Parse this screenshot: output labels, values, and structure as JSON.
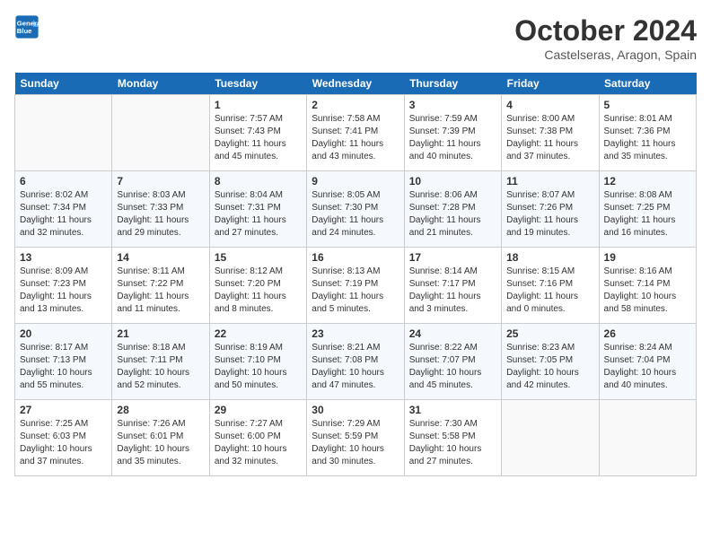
{
  "header": {
    "logo_line1": "General",
    "logo_line2": "Blue",
    "month": "October 2024",
    "location": "Castelseras, Aragon, Spain"
  },
  "days_of_week": [
    "Sunday",
    "Monday",
    "Tuesday",
    "Wednesday",
    "Thursday",
    "Friday",
    "Saturday"
  ],
  "weeks": [
    [
      {
        "day": "",
        "sunrise": "",
        "sunset": "",
        "daylight": ""
      },
      {
        "day": "",
        "sunrise": "",
        "sunset": "",
        "daylight": ""
      },
      {
        "day": "1",
        "sunrise": "Sunrise: 7:57 AM",
        "sunset": "Sunset: 7:43 PM",
        "daylight": "Daylight: 11 hours and 45 minutes."
      },
      {
        "day": "2",
        "sunrise": "Sunrise: 7:58 AM",
        "sunset": "Sunset: 7:41 PM",
        "daylight": "Daylight: 11 hours and 43 minutes."
      },
      {
        "day": "3",
        "sunrise": "Sunrise: 7:59 AM",
        "sunset": "Sunset: 7:39 PM",
        "daylight": "Daylight: 11 hours and 40 minutes."
      },
      {
        "day": "4",
        "sunrise": "Sunrise: 8:00 AM",
        "sunset": "Sunset: 7:38 PM",
        "daylight": "Daylight: 11 hours and 37 minutes."
      },
      {
        "day": "5",
        "sunrise": "Sunrise: 8:01 AM",
        "sunset": "Sunset: 7:36 PM",
        "daylight": "Daylight: 11 hours and 35 minutes."
      }
    ],
    [
      {
        "day": "6",
        "sunrise": "Sunrise: 8:02 AM",
        "sunset": "Sunset: 7:34 PM",
        "daylight": "Daylight: 11 hours and 32 minutes."
      },
      {
        "day": "7",
        "sunrise": "Sunrise: 8:03 AM",
        "sunset": "Sunset: 7:33 PM",
        "daylight": "Daylight: 11 hours and 29 minutes."
      },
      {
        "day": "8",
        "sunrise": "Sunrise: 8:04 AM",
        "sunset": "Sunset: 7:31 PM",
        "daylight": "Daylight: 11 hours and 27 minutes."
      },
      {
        "day": "9",
        "sunrise": "Sunrise: 8:05 AM",
        "sunset": "Sunset: 7:30 PM",
        "daylight": "Daylight: 11 hours and 24 minutes."
      },
      {
        "day": "10",
        "sunrise": "Sunrise: 8:06 AM",
        "sunset": "Sunset: 7:28 PM",
        "daylight": "Daylight: 11 hours and 21 minutes."
      },
      {
        "day": "11",
        "sunrise": "Sunrise: 8:07 AM",
        "sunset": "Sunset: 7:26 PM",
        "daylight": "Daylight: 11 hours and 19 minutes."
      },
      {
        "day": "12",
        "sunrise": "Sunrise: 8:08 AM",
        "sunset": "Sunset: 7:25 PM",
        "daylight": "Daylight: 11 hours and 16 minutes."
      }
    ],
    [
      {
        "day": "13",
        "sunrise": "Sunrise: 8:09 AM",
        "sunset": "Sunset: 7:23 PM",
        "daylight": "Daylight: 11 hours and 13 minutes."
      },
      {
        "day": "14",
        "sunrise": "Sunrise: 8:11 AM",
        "sunset": "Sunset: 7:22 PM",
        "daylight": "Daylight: 11 hours and 11 minutes."
      },
      {
        "day": "15",
        "sunrise": "Sunrise: 8:12 AM",
        "sunset": "Sunset: 7:20 PM",
        "daylight": "Daylight: 11 hours and 8 minutes."
      },
      {
        "day": "16",
        "sunrise": "Sunrise: 8:13 AM",
        "sunset": "Sunset: 7:19 PM",
        "daylight": "Daylight: 11 hours and 5 minutes."
      },
      {
        "day": "17",
        "sunrise": "Sunrise: 8:14 AM",
        "sunset": "Sunset: 7:17 PM",
        "daylight": "Daylight: 11 hours and 3 minutes."
      },
      {
        "day": "18",
        "sunrise": "Sunrise: 8:15 AM",
        "sunset": "Sunset: 7:16 PM",
        "daylight": "Daylight: 11 hours and 0 minutes."
      },
      {
        "day": "19",
        "sunrise": "Sunrise: 8:16 AM",
        "sunset": "Sunset: 7:14 PM",
        "daylight": "Daylight: 10 hours and 58 minutes."
      }
    ],
    [
      {
        "day": "20",
        "sunrise": "Sunrise: 8:17 AM",
        "sunset": "Sunset: 7:13 PM",
        "daylight": "Daylight: 10 hours and 55 minutes."
      },
      {
        "day": "21",
        "sunrise": "Sunrise: 8:18 AM",
        "sunset": "Sunset: 7:11 PM",
        "daylight": "Daylight: 10 hours and 52 minutes."
      },
      {
        "day": "22",
        "sunrise": "Sunrise: 8:19 AM",
        "sunset": "Sunset: 7:10 PM",
        "daylight": "Daylight: 10 hours and 50 minutes."
      },
      {
        "day": "23",
        "sunrise": "Sunrise: 8:21 AM",
        "sunset": "Sunset: 7:08 PM",
        "daylight": "Daylight: 10 hours and 47 minutes."
      },
      {
        "day": "24",
        "sunrise": "Sunrise: 8:22 AM",
        "sunset": "Sunset: 7:07 PM",
        "daylight": "Daylight: 10 hours and 45 minutes."
      },
      {
        "day": "25",
        "sunrise": "Sunrise: 8:23 AM",
        "sunset": "Sunset: 7:05 PM",
        "daylight": "Daylight: 10 hours and 42 minutes."
      },
      {
        "day": "26",
        "sunrise": "Sunrise: 8:24 AM",
        "sunset": "Sunset: 7:04 PM",
        "daylight": "Daylight: 10 hours and 40 minutes."
      }
    ],
    [
      {
        "day": "27",
        "sunrise": "Sunrise: 7:25 AM",
        "sunset": "Sunset: 6:03 PM",
        "daylight": "Daylight: 10 hours and 37 minutes."
      },
      {
        "day": "28",
        "sunrise": "Sunrise: 7:26 AM",
        "sunset": "Sunset: 6:01 PM",
        "daylight": "Daylight: 10 hours and 35 minutes."
      },
      {
        "day": "29",
        "sunrise": "Sunrise: 7:27 AM",
        "sunset": "Sunset: 6:00 PM",
        "daylight": "Daylight: 10 hours and 32 minutes."
      },
      {
        "day": "30",
        "sunrise": "Sunrise: 7:29 AM",
        "sunset": "Sunset: 5:59 PM",
        "daylight": "Daylight: 10 hours and 30 minutes."
      },
      {
        "day": "31",
        "sunrise": "Sunrise: 7:30 AM",
        "sunset": "Sunset: 5:58 PM",
        "daylight": "Daylight: 10 hours and 27 minutes."
      },
      {
        "day": "",
        "sunrise": "",
        "sunset": "",
        "daylight": ""
      },
      {
        "day": "",
        "sunrise": "",
        "sunset": "",
        "daylight": ""
      }
    ]
  ]
}
